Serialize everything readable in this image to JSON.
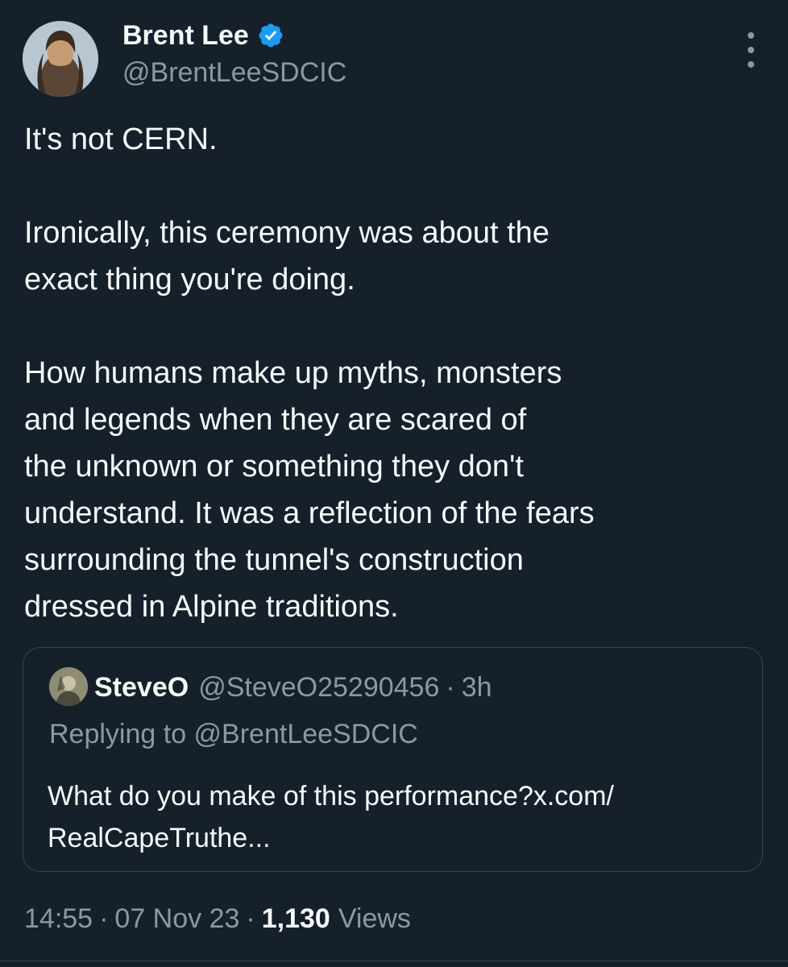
{
  "author": {
    "name": "Brent Lee",
    "handle": "@BrentLeeSDCIC",
    "verified": true
  },
  "tweet": {
    "paragraphs": [
      "It's not CERN.",
      "Ironically, this ceremony was about the\nexact thing you're doing.",
      "How humans make up myths, monsters\nand legends when they are scared of\nthe unknown or something they don't\nunderstand. It was a reflection of the fears\nsurrounding the tunnel's construction\ndressed in Alpine traditions."
    ]
  },
  "quote": {
    "name": "SteveO",
    "handle": "@SteveO25290456",
    "separator": "·",
    "time": "3h",
    "replying_to": "Replying to @BrentLeeSDCIC",
    "text": "What do you make of this performance?x.com/\nRealCapeTruthe..."
  },
  "meta": {
    "time": "14:55",
    "separator": "·",
    "date": "07 Nov 23",
    "views_count": "1,130",
    "views_label": "Views"
  },
  "colors": {
    "background": "#15202b",
    "text": "#f7f9f9",
    "secondary": "#8b98a5",
    "border": "#38444d",
    "verified": "#1d9bf0"
  },
  "icons": {
    "verified": "verified-badge-icon",
    "more": "more-options-icon"
  }
}
